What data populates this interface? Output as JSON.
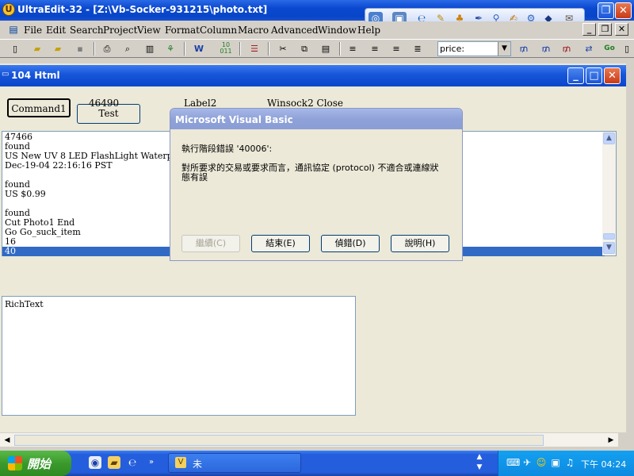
{
  "ue": {
    "title": "UltraEdit-32 - [Z:\\Vb-Socker-931215\\photo.txt]",
    "menu": [
      "File",
      "Edit",
      "Search",
      "Project",
      "View",
      "Format",
      "Column",
      "Macro",
      "Advanced",
      "Window",
      "Help"
    ],
    "find_value": "price:",
    "win_buttons": {
      "restore": "❐",
      "close": "✕"
    }
  },
  "vbform": {
    "title": "104 Html",
    "command1": "Command1",
    "test": "Test",
    "num": "46490",
    "label2": "Label2",
    "winsock": "Winsock2 Close",
    "list": [
      "47466",
      "found",
      "US New UV 8 LED FlashLight Waterproof U",
      "Dec-19-04 22:16:16 PST",
      "",
      "found",
      "US $0.99",
      "",
      "found",
      "Cut Photo1 End",
      "Go Go_suck_item",
      "16",
      "40"
    ],
    "selected_index": 12,
    "richtext": "RichText"
  },
  "dialog": {
    "title": "Microsoft Visual Basic",
    "line1": "執行階段錯誤 '40006':",
    "line2": "對所要求的交易或要求而言，通訊協定 (protocol) 不適合或連線狀",
    "line3": "態有誤",
    "buttons": [
      "繼續(C)",
      "結束(E)",
      "偵錯(D)",
      "說明(H)"
    ]
  },
  "taskbar": {
    "start": "開始",
    "task": "未",
    "clock": "下午 04:24"
  }
}
